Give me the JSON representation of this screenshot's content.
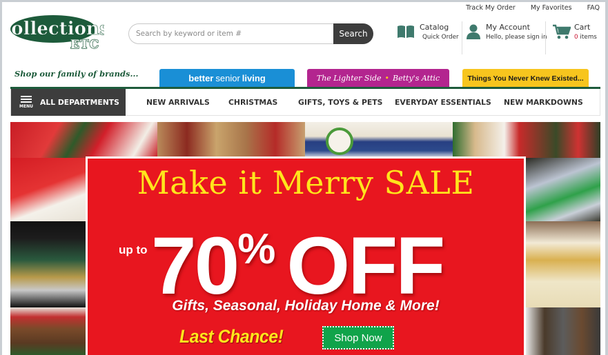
{
  "utility_links": [
    "Track My Order",
    "My Favorites",
    "FAQ"
  ],
  "logo": {
    "line1": "Collections",
    "line2": "ETC",
    "alt": "Collections Etc."
  },
  "search": {
    "placeholder": "Search by keyword or item #",
    "value": "",
    "button_label": "Search"
  },
  "header_tools": {
    "catalog": {
      "icon": "book-icon",
      "title": "Catalog",
      "subtitle": "Quick Order"
    },
    "account": {
      "icon": "user-icon",
      "title": "My Account",
      "subtitle": "Hello, please sign in"
    },
    "cart": {
      "icon": "cart-icon",
      "title": "Cart",
      "count": "0",
      "count_suffix": "items"
    }
  },
  "brands": {
    "label": "Shop our family of brands...",
    "items": [
      {
        "name": "better senior living",
        "part1": "better",
        "part2": "senior",
        "part3": "living",
        "color": "#1a8fd6"
      },
      {
        "name": "The Lighter Side • Betty's Attic",
        "part1": "The Lighter Side",
        "sep": "•",
        "part2": "Betty's Attic",
        "color": "#b3258f"
      },
      {
        "name": "Things You Never Knew Existed...",
        "color": "#f7c51e"
      }
    ]
  },
  "nav": {
    "menu_label": "MENU",
    "all_departments": "ALL DEPARTMENTS",
    "items": [
      "NEW ARRIVALS",
      "CHRISTMAS",
      "GIFTS, TOYS & PETS",
      "EVERYDAY ESSENTIALS",
      "NEW MARKDOWNS"
    ]
  },
  "hero": {
    "headline": "Make it Merry SALE",
    "up_to": "up to",
    "percent": "70",
    "percent_sign": "%",
    "off": "OFF",
    "subline": "Gifts, Seasonal, Holiday Home & More!",
    "last_chance": "Last Chance!",
    "cta": "Shop Now",
    "colors": {
      "background": "#e8161f",
      "headline": "#ffe51c",
      "cta": "#10a34a"
    }
  }
}
